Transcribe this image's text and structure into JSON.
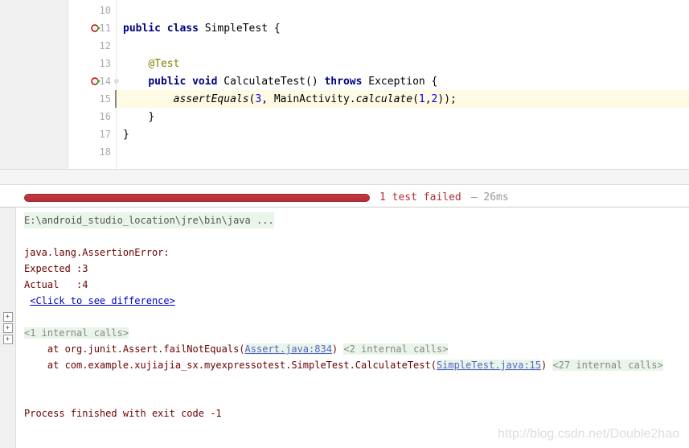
{
  "editor": {
    "lines": [
      {
        "num": "10",
        "code": ""
      },
      {
        "num": "11",
        "code": "public class SimpleTest {",
        "runIcon": true
      },
      {
        "num": "12",
        "code": ""
      },
      {
        "num": "13",
        "code": "    @Test",
        "anno": true
      },
      {
        "num": "14",
        "code": "    public void CalculateTest() throws Exception {",
        "runIcon": true,
        "fold": true
      },
      {
        "num": "15",
        "code": "        assertEquals(3, MainActivity.calculate(1,2));",
        "highlight": true
      },
      {
        "num": "16",
        "code": "    }"
      },
      {
        "num": "17",
        "code": "}"
      },
      {
        "num": "18",
        "code": ""
      }
    ],
    "tokens": {
      "l11_kw1": "public ",
      "l11_kw2": "class ",
      "l11_name": "SimpleTest {",
      "l13_anno": "@Test",
      "l13_pad": "    ",
      "l14_pad": "    ",
      "l14_kw1": "public ",
      "l14_kw2": "void ",
      "l14_name": "CalculateTest() ",
      "l14_kw3": "throws ",
      "l14_exc": "Exception {",
      "l15_pad": "        ",
      "l15_method": "assertEquals",
      "l15_p1": "(",
      "l15_n1": "3",
      "l15_c": ", MainActivity.",
      "l15_method2": "calculate",
      "l15_p2": "(",
      "l15_n2": "1",
      "l15_cm": ",",
      "l15_n3": "2",
      "l15_end": "));",
      "l16_pad": "    ",
      "l16_brace": "}",
      "l17_brace": "}"
    }
  },
  "testResult": {
    "status": "1 test failed",
    "time": "– 26ms"
  },
  "output": {
    "cmd": "E:\\android_studio_location\\jre\\bin\\java ...",
    "error": "java.lang.AssertionError:",
    "expected_label": "Expected :",
    "expected_value": "3",
    "actual_label": "Actual   :",
    "actual_value": "4",
    "diff_link": "<Click to see difference>",
    "internal1": "<1 internal calls>",
    "trace1_pre": "    at org.junit.Assert.failNotEquals(",
    "trace1_link": "Assert.java:834",
    "trace1_post": ") ",
    "trace1_int": "<2 internal calls>",
    "trace2_pre": "    at com.example.xujiajia_sx.myexpressotest.SimpleTest.CalculateTest(",
    "trace2_link": "SimpleTest.java:15",
    "trace2_post": ") ",
    "trace2_int": "<27 internal calls>",
    "exit": "Process finished with exit code -1"
  },
  "watermark": "http://blog.csdn.net/Double2hao"
}
